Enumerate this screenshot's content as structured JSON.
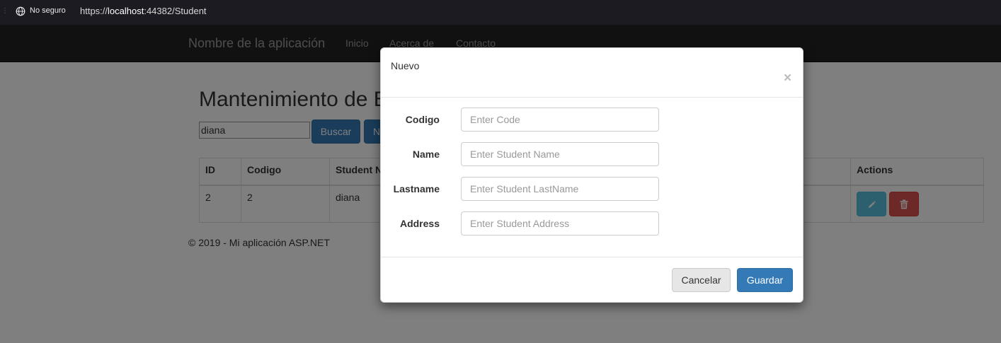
{
  "browser": {
    "security_label": "No seguro",
    "url_prefix": "https://",
    "url_host": "localhost",
    "url_rest": ":44382/Student"
  },
  "navbar": {
    "brand": "Nombre de la aplicación",
    "links": [
      "Inicio",
      "Acerca de",
      "Contacto"
    ]
  },
  "page": {
    "title": "Mantenimiento de E",
    "search_value": "diana",
    "search_button": "Buscar",
    "new_button": "N"
  },
  "table": {
    "columns": [
      "ID",
      "Codigo",
      "Student N",
      "Actions"
    ],
    "rows": [
      {
        "id": "2",
        "codigo": "2",
        "student_name": "diana"
      }
    ]
  },
  "footer": {
    "text": "© 2019 - Mi aplicación ASP.NET"
  },
  "modal": {
    "title": "Nuevo",
    "close": "×",
    "fields": [
      {
        "label": "Codigo",
        "placeholder": "Enter Code"
      },
      {
        "label": "Name",
        "placeholder": "Enter Student Name"
      },
      {
        "label": "Lastname",
        "placeholder": "Enter Student LastName"
      },
      {
        "label": "Address",
        "placeholder": "Enter Student Address"
      }
    ],
    "cancel_label": "Cancelar",
    "save_label": "Guardar"
  },
  "icons": {
    "security": "globe-icon",
    "edit": "pencil-icon",
    "delete": "trash-icon"
  },
  "colors": {
    "primary": "#337ab7",
    "info": "#5bc0de",
    "danger": "#d9534f",
    "navbar": "#222222"
  }
}
